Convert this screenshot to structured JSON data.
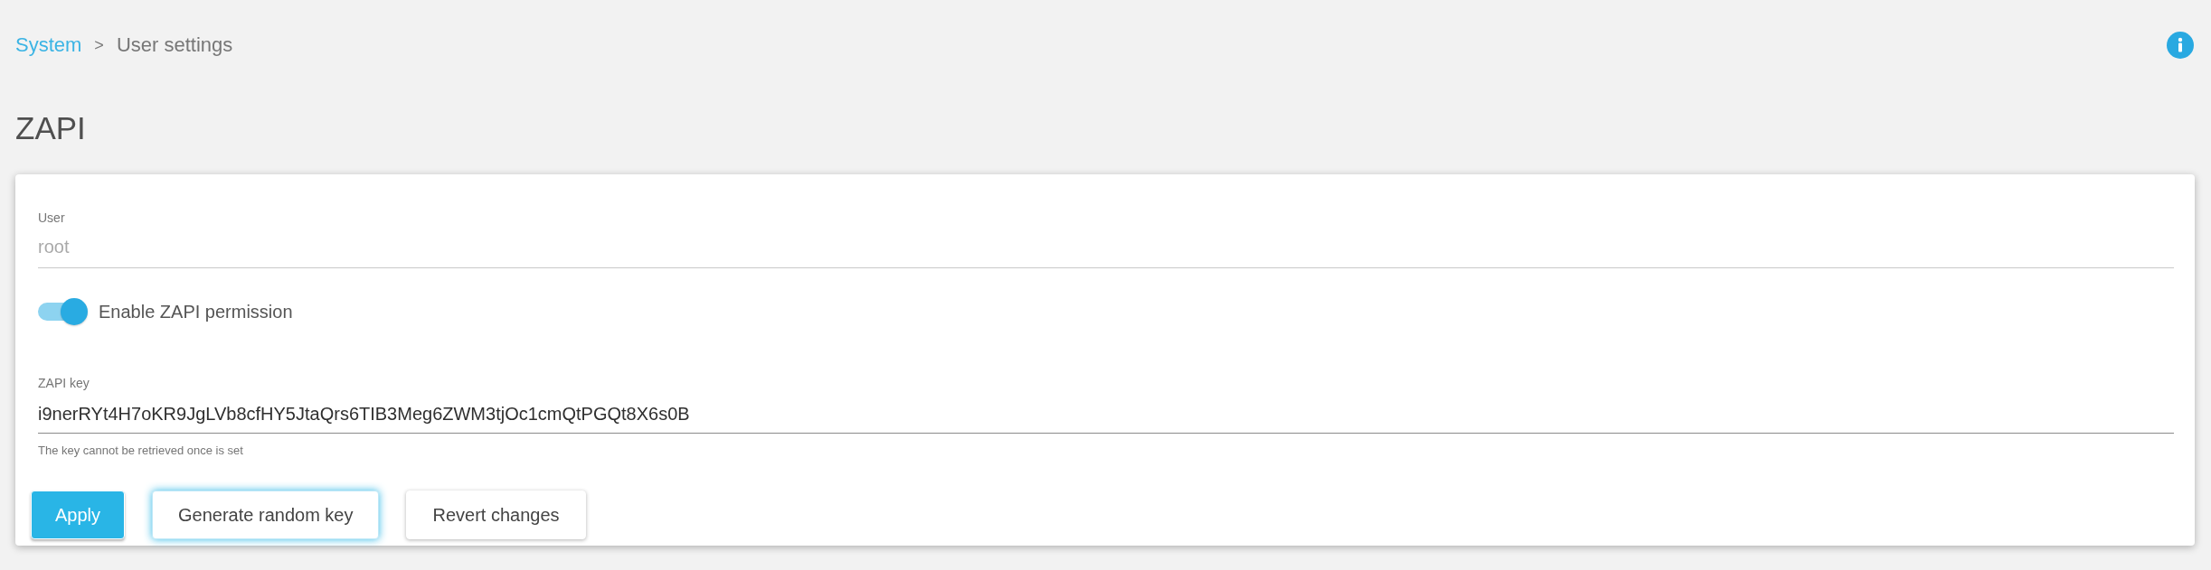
{
  "breadcrumb": {
    "link": "System",
    "separator": ">",
    "current": "User settings"
  },
  "page_title": "ZAPI",
  "form": {
    "user": {
      "label": "User",
      "value": "root",
      "disabled": true
    },
    "permission": {
      "label": "Enable ZAPI permission",
      "on": true
    },
    "key": {
      "label": "ZAPI key",
      "value": "i9nerRYt4H7oKR9JgLVb8cfHY5JtaQrs6TIB3Meg6ZWM3tjOc1cmQtPGQt8X6s0B",
      "disabled": false,
      "helper": "The key cannot be retrieved once is set"
    }
  },
  "buttons": [
    {
      "label": "Apply",
      "kind": "primary",
      "focused": false
    },
    {
      "label": "Generate random key",
      "kind": "default",
      "focused": true
    },
    {
      "label": "Revert changes",
      "kind": "default",
      "focused": false
    }
  ]
}
